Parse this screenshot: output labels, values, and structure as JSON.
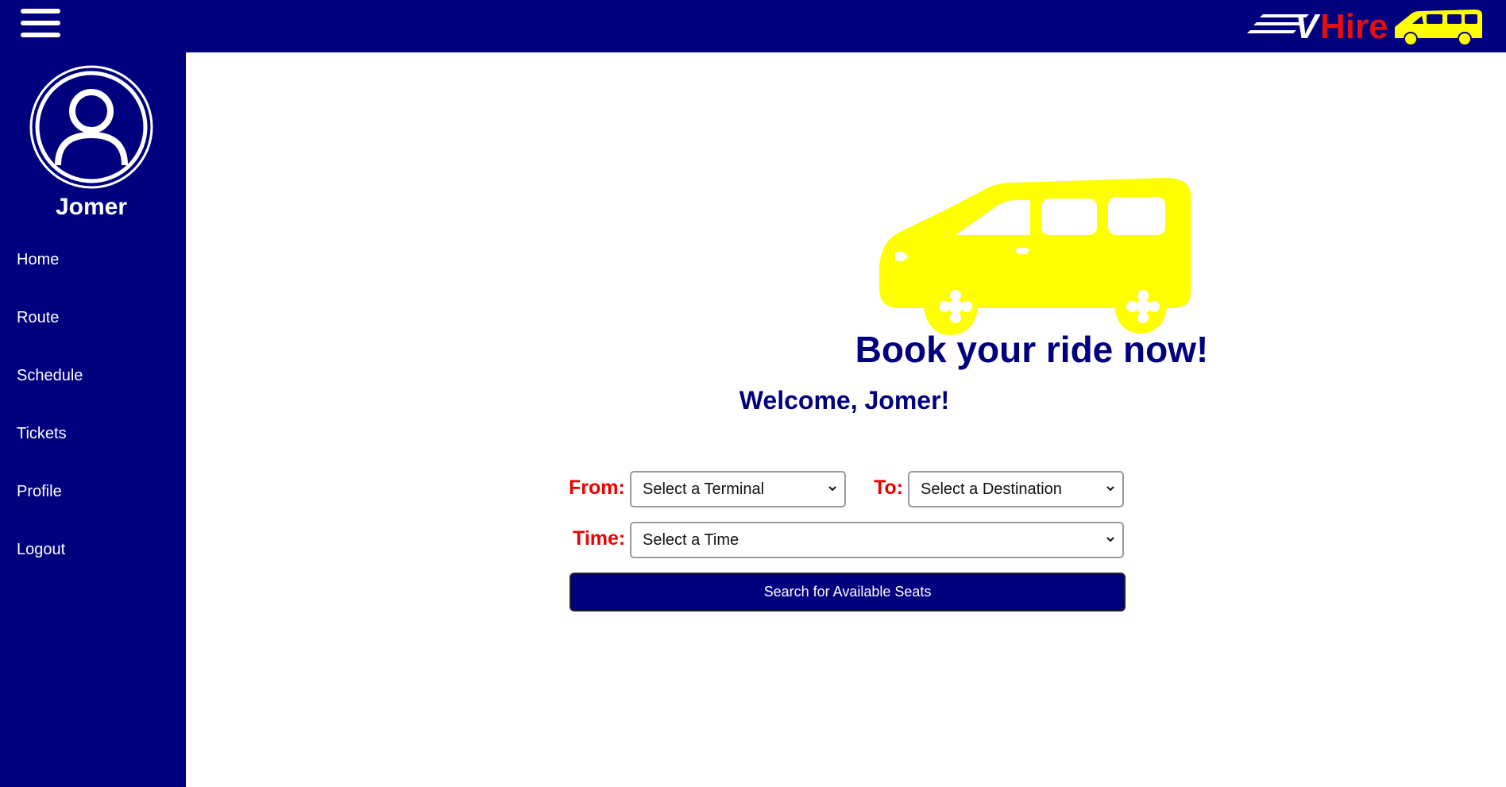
{
  "brand": {
    "name_prefix": "V",
    "name_suffix": "Hire",
    "prefix_color": "#ffffff",
    "suffix_color": "#e01010",
    "van_color": "#ffff00"
  },
  "colors": {
    "primary": "#00007f",
    "label_red": "#ee0000",
    "background": "#ffffff"
  },
  "sidebar": {
    "username": "Jomer",
    "items": [
      {
        "label": "Home"
      },
      {
        "label": "Route"
      },
      {
        "label": "Schedule"
      },
      {
        "label": "Tickets"
      },
      {
        "label": "Profile"
      },
      {
        "label": "Logout"
      }
    ]
  },
  "main": {
    "hero_text": "Book your ride now!",
    "welcome": "Welcome, Jomer!",
    "form": {
      "from_label": "From:",
      "from_value": "Select a Terminal",
      "to_label": "To:",
      "to_value": "Select a Destination",
      "time_label": "Time:",
      "time_value": "Select a Time",
      "search_label": "Search for Available Seats"
    }
  },
  "icons": {
    "menu": "hamburger-menu-icon",
    "avatar": "user-avatar-icon",
    "dropdown": "chevron-down-icon"
  }
}
